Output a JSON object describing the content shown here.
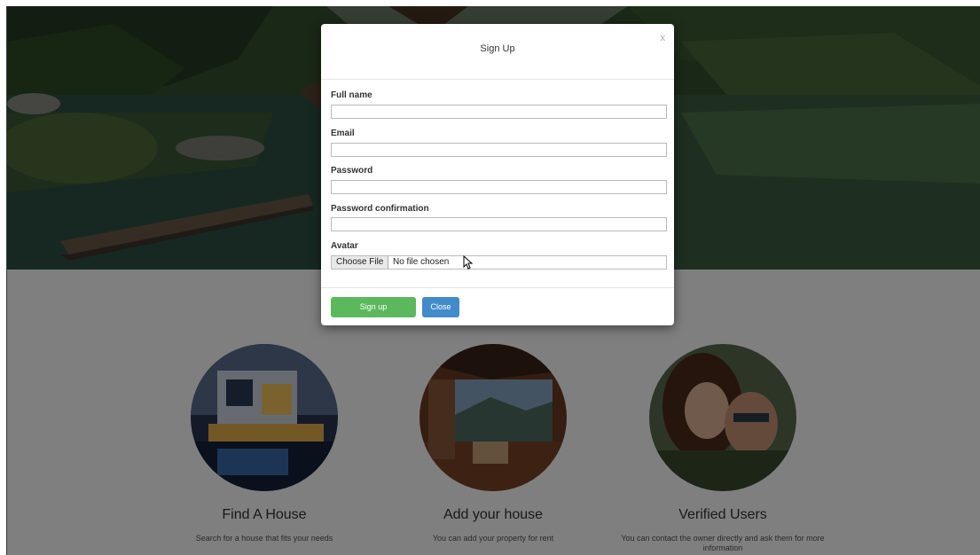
{
  "modal": {
    "title": "Sign Up",
    "close_symbol": "x",
    "fields": [
      {
        "label": "Full name",
        "value": ""
      },
      {
        "label": "Email",
        "value": ""
      },
      {
        "label": "Password",
        "value": ""
      },
      {
        "label": "Password confirmation",
        "value": ""
      }
    ],
    "avatar": {
      "label": "Avatar",
      "button_label": "Choose File",
      "status": "No file chosen"
    },
    "buttons": {
      "signup": "Sign up",
      "close": "Close"
    }
  },
  "features": [
    {
      "title": "Find A House",
      "description": "Search for a house that fits your needs",
      "image": "modern-house-photo"
    },
    {
      "title": "Add your house",
      "description": "You can add your property for rent",
      "image": "porch-mountain-view-photo"
    },
    {
      "title": "Verified Users",
      "description": "You can contact the owner directly and ask them for more information",
      "image": "couple-photo"
    }
  ],
  "hero": {
    "image": "lake-forest-photo"
  },
  "colors": {
    "signup_button": "#5cb85c",
    "close_button": "#428bca",
    "backdrop": "rgba(0,0,0,0.5)"
  }
}
